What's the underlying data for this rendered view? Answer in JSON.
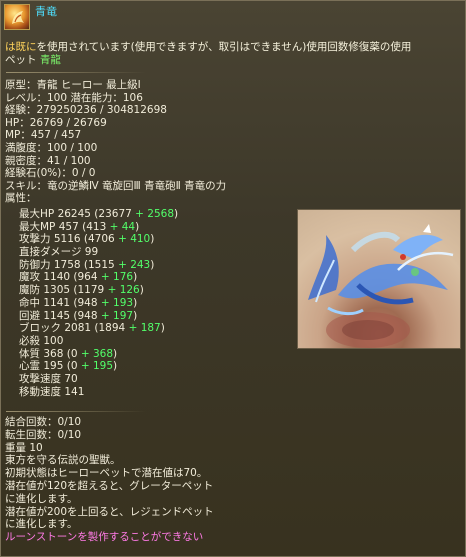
{
  "item": {
    "name": "青竜",
    "icon": "blue-dragon-egg-icon"
  },
  "notice": {
    "highlight": "は既に",
    "text": "を使用されています(使用できますが、取引はできません)使用回数修復薬の使用"
  },
  "pet_line": {
    "label": "ペット",
    "pet_name": "青龍"
  },
  "stats": [
    "原型：青龍 ヒーロー 最上級Ⅰ",
    "レベル：100 潜在能力：106",
    "経験：279250236 / 304812698",
    "HP：26769 / 26769",
    "MP：457 / 457",
    "満腹度：100 / 100",
    "親密度：41 / 100",
    "経験石(0%)：0 / 0",
    "スキル：竜の逆鱗Ⅳ 竜旋回Ⅲ 青竜砲Ⅱ 青竜の力",
    "属性："
  ],
  "attributes": [
    {
      "base": "最大HP 26245 (23677 ",
      "bonus": "+ 2568",
      "end": ")"
    },
    {
      "base": "最大MP 457 (413 ",
      "bonus": "+ 44",
      "end": ")"
    },
    {
      "base": "攻撃力 5116 (4706 ",
      "bonus": "+ 410",
      "end": ")"
    },
    {
      "base": "直接ダメージ 99",
      "bonus": "",
      "end": ""
    },
    {
      "base": "防御力 1758 (1515 ",
      "bonus": "+ 243",
      "end": ")"
    },
    {
      "base": "魔攻 1140 (964 ",
      "bonus": "+ 176",
      "end": ")"
    },
    {
      "base": "魔防 1305 (1179 ",
      "bonus": "+ 126",
      "end": ")"
    },
    {
      "base": "命中 1141 (948 ",
      "bonus": "+ 193",
      "end": ")"
    },
    {
      "base": "回避 1145 (948 ",
      "bonus": "+ 197",
      "end": ")"
    },
    {
      "base": "ブロック 2081 (1894 ",
      "bonus": "+ 187",
      "end": ")"
    },
    {
      "base": "必殺 100",
      "bonus": "",
      "end": ""
    },
    {
      "base": "体質 368 (0 ",
      "bonus": "+ 368",
      "end": ")"
    },
    {
      "base": "心霊 195 (0 ",
      "bonus": "+ 195",
      "end": ")"
    },
    {
      "base": "攻撃速度 70",
      "bonus": "",
      "end": ""
    },
    {
      "base": "移動速度 141",
      "bonus": "",
      "end": ""
    }
  ],
  "extra": [
    "結合回数：0/10",
    "転生回数：0/10",
    "重量 10",
    "東方を守る伝説の聖獣。",
    "初期状態はヒーローペットで潜在値は70。",
    "潜在値が120を超えると、グレーターペット",
    "に進化します。",
    "潜在値が200を上回ると、レジェンドペット",
    "に進化します。"
  ],
  "warning": "ルーンストーンを製作することができない",
  "pet_image": {
    "label": "blue-dragon-pet-image"
  },
  "colors": {
    "item_name": "#4fe0ff",
    "bonus": "#52ff6a",
    "pet_name": "#7bf06a",
    "highlight": "#ffd35c",
    "warning": "#ff7ae6"
  }
}
